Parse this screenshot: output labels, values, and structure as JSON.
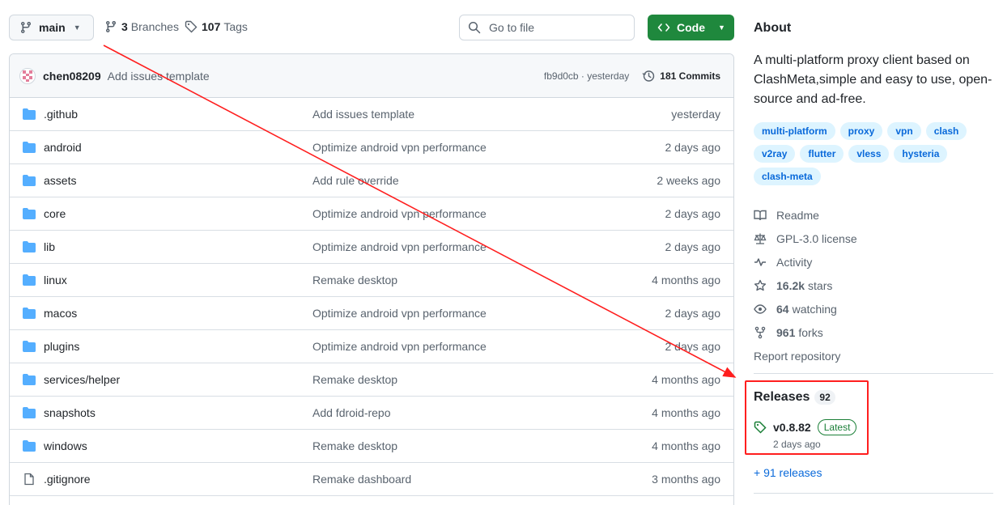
{
  "top": {
    "branch": "main",
    "branches_count": "3",
    "branches_label": "Branches",
    "tags_count": "107",
    "tags_label": "Tags",
    "search_placeholder": "Go to file",
    "code_label": "Code"
  },
  "commit": {
    "author": "chen08209",
    "message": "Add issues template",
    "hash_time": "fb9d0cb · yesterday",
    "commits_label": "181 Commits"
  },
  "files": [
    {
      "name": ".github",
      "message": "Add issues template",
      "date": "yesterday",
      "type": "folder"
    },
    {
      "name": "android",
      "message": "Optimize android vpn performance",
      "date": "2 days ago",
      "type": "folder"
    },
    {
      "name": "assets",
      "message": "Add rule override",
      "date": "2 weeks ago",
      "type": "folder"
    },
    {
      "name": "core",
      "message": "Optimize android vpn performance",
      "date": "2 days ago",
      "type": "folder"
    },
    {
      "name": "lib",
      "message": "Optimize android vpn performance",
      "date": "2 days ago",
      "type": "folder"
    },
    {
      "name": "linux",
      "message": "Remake desktop",
      "date": "4 months ago",
      "type": "folder"
    },
    {
      "name": "macos",
      "message": "Optimize android vpn performance",
      "date": "2 days ago",
      "type": "folder"
    },
    {
      "name": "plugins",
      "message": "Optimize android vpn performance",
      "date": "2 days ago",
      "type": "folder"
    },
    {
      "name": "services/helper",
      "message": "Remake desktop",
      "date": "4 months ago",
      "type": "folder"
    },
    {
      "name": "snapshots",
      "message": "Add fdroid-repo",
      "date": "4 months ago",
      "type": "folder"
    },
    {
      "name": "windows",
      "message": "Remake desktop",
      "date": "4 months ago",
      "type": "folder"
    },
    {
      "name": ".gitignore",
      "message": "Remake dashboard",
      "date": "3 months ago",
      "type": "file"
    }
  ],
  "about": {
    "title": "About",
    "description": "A multi-platform proxy client based on ClashMeta,simple and easy to use, open-source and ad-free.",
    "topics": [
      "multi-platform",
      "proxy",
      "vpn",
      "clash",
      "v2ray",
      "flutter",
      "vless",
      "hysteria",
      "clash-meta"
    ],
    "readme": "Readme",
    "license": "GPL-3.0 license",
    "activity": "Activity",
    "stars_count": "16.2k",
    "stars_label": "stars",
    "watching_count": "64",
    "watching_label": "watching",
    "forks_count": "961",
    "forks_label": "forks",
    "report": "Report repository"
  },
  "releases": {
    "title": "Releases",
    "count": "92",
    "latest_name": "v0.8.82",
    "latest_badge": "Latest",
    "latest_date": "2 days ago",
    "more": "+ 91 releases"
  },
  "colors": {
    "accent": "#0969da",
    "code_green": "#1f883d",
    "folder_blue": "#54aeff",
    "annotation_red": "#ff1e1e"
  }
}
